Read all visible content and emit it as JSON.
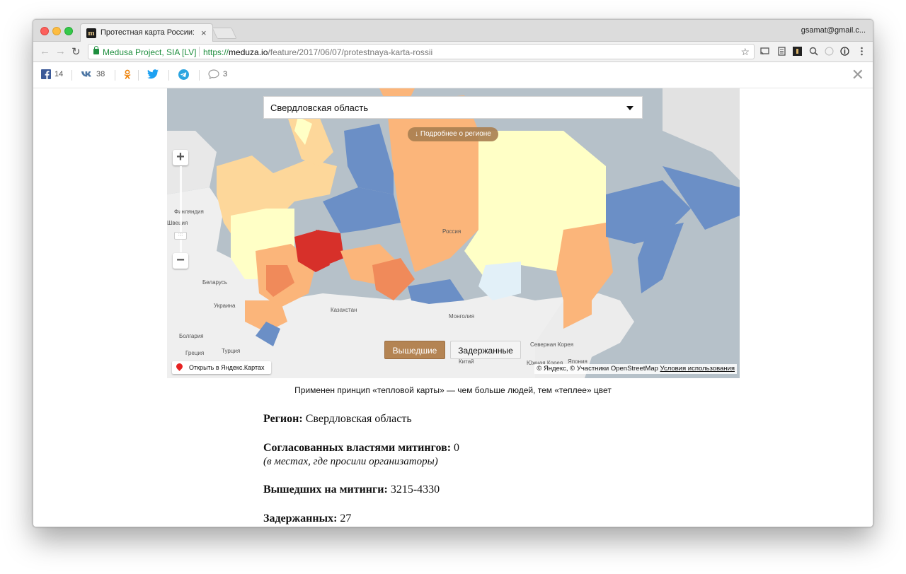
{
  "browser": {
    "tab_title": "Протестная карта России: Ск",
    "tab_close": "×",
    "profile": "gsamat@gmail.c...",
    "secure_label": "Medusa Project, SIA [LV]",
    "url_scheme": "https://",
    "url_domain": "meduza.io",
    "url_path": "/feature/2017/06/07/protestnaya-karta-rossii"
  },
  "share": {
    "facebook_count": "14",
    "vk_count": "38",
    "comments_count": "3",
    "close": "✕"
  },
  "map": {
    "selected_region": "Свердловская область",
    "more_button": "↓ Подробнее о регионе",
    "zoom_in": "+",
    "zoom_out": "−",
    "toggle_attended": "Вышедшие",
    "toggle_detained": "Задержанные",
    "yandex_open": "Открыть в Яндекс.Картах",
    "copyright": "© Яндекс, © Участники OpenStreetMap",
    "terms": "Условия использования",
    "labels": {
      "finland": "Финляндия",
      "sweden": "Швеция",
      "belarus": "Беларусь",
      "ukraine": "Украина",
      "bulgaria": "Болгария",
      "greece": "Греция",
      "turkey": "Турция",
      "kazakhstan": "Казахстан",
      "mongolia": "Монголия",
      "china": "Китай",
      "north_korea": "Северная Корея",
      "south_korea": "Южная Корея",
      "japan": "Япония",
      "russia": "Россия"
    },
    "colors": {
      "hot": "#d7302a",
      "warm": "#f08a5a",
      "orange": "#fbb57a",
      "light_orange": "#fdd79a",
      "pale": "#ffffc6",
      "cool": "#e2f0f8",
      "blue": "#6b8fc6",
      "land": "#efefef",
      "sea": "#b6c1c9"
    }
  },
  "caption": "Применен принцип «тепловой карты» — чем больше людей, тем «теплее» цвет",
  "facts": {
    "region_label": "Регион:",
    "region_value": "Свердловская область",
    "approved_label": "Согласованных властями митингов:",
    "approved_value": "0",
    "approved_note": "(в местах, где просили организаторы)",
    "attended_label": "Вышедших на митинги:",
    "attended_value": "3215-4330",
    "detained_label": "Задержанных:",
    "detained_value": "27"
  }
}
